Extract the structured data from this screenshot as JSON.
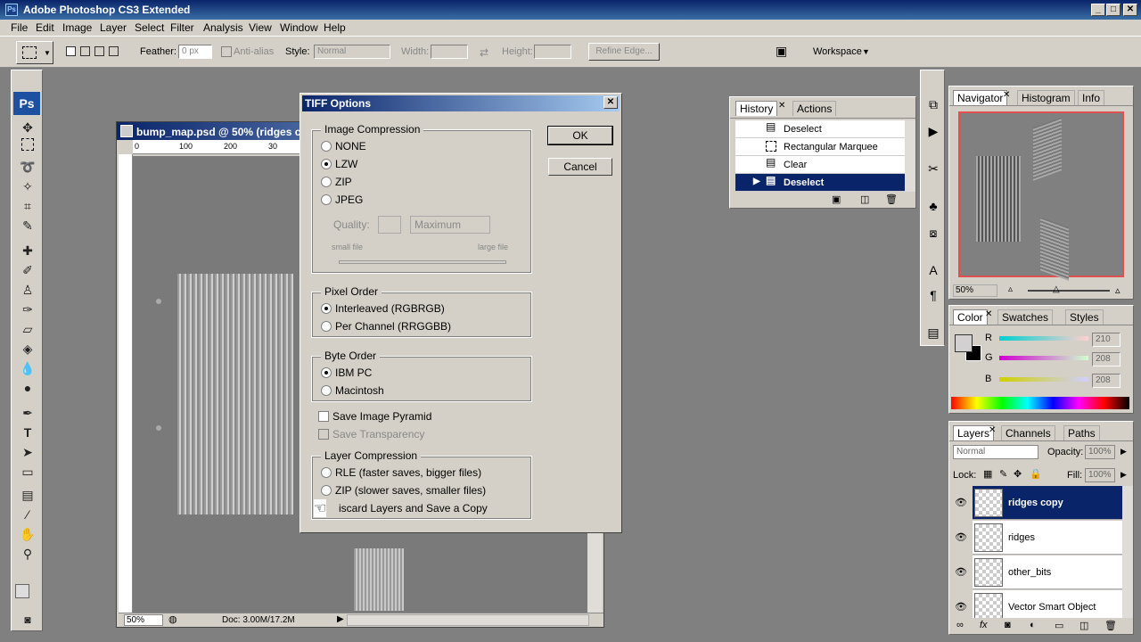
{
  "window": {
    "title": "Adobe Photoshop CS3 Extended",
    "app_icon": "Ps"
  },
  "menu": [
    "File",
    "Edit",
    "Image",
    "Layer",
    "Select",
    "Filter",
    "Analysis",
    "View",
    "Window",
    "Help"
  ],
  "options": {
    "feather_label": "Feather:",
    "feather_value": "0 px",
    "antialias_label": "Anti-alias",
    "style_label": "Style:",
    "style_value": "Normal",
    "width_label": "Width:",
    "height_label": "Height:",
    "refine_edge": "Refine Edge...",
    "workspace": "Workspace"
  },
  "toolbox": {
    "logo": "Ps"
  },
  "document": {
    "title": "bump_map.psd @ 50% (ridges c",
    "ruler_top": [
      "0",
      "100",
      "200",
      "30"
    ],
    "zoom": "50%",
    "doc_info": "Doc: 3.00M/17.2M"
  },
  "dialog": {
    "title": "TIFF Options",
    "ok": "OK",
    "cancel": "Cancel",
    "image_compression": {
      "label": "Image Compression",
      "options": [
        "NONE",
        "LZW",
        "ZIP",
        "JPEG"
      ],
      "selected": "LZW",
      "quality_label": "Quality:",
      "quality_select": "Maximum",
      "small_file": "small file",
      "large_file": "large file"
    },
    "pixel_order": {
      "label": "Pixel Order",
      "options": [
        "Interleaved (RGBRGB)",
        "Per Channel (RRGGBB)"
      ],
      "selected": "Interleaved (RGBRGB)"
    },
    "byte_order": {
      "label": "Byte Order",
      "options": [
        "IBM PC",
        "Macintosh"
      ],
      "selected": "IBM PC"
    },
    "save_pyramid": "Save Image Pyramid",
    "save_transparency": "Save Transparency",
    "layer_compression": {
      "label": "Layer Compression",
      "options": [
        "RLE (faster saves, bigger files)",
        "ZIP (slower saves, smaller files)",
        "Discard Layers and Save a Copy"
      ]
    },
    "discard_visible": "iscard Layers and Save a Copy"
  },
  "history": {
    "tabs": [
      "History",
      "Actions"
    ],
    "items": [
      "Deselect",
      "Rectangular Marquee",
      "Clear",
      "Deselect"
    ],
    "selected_index": 3
  },
  "navigator": {
    "tabs": [
      "Navigator",
      "Histogram",
      "Info"
    ],
    "zoom": "50%"
  },
  "color": {
    "tabs": [
      "Color",
      "Swatches",
      "Styles"
    ],
    "channels": [
      {
        "name": "R",
        "value": "210"
      },
      {
        "name": "G",
        "value": "208"
      },
      {
        "name": "B",
        "value": "208"
      }
    ]
  },
  "layers": {
    "tabs": [
      "Layers",
      "Channels",
      "Paths"
    ],
    "blend": "Normal",
    "opacity_label": "Opacity:",
    "opacity": "100%",
    "lock_label": "Lock:",
    "fill_label": "Fill:",
    "fill": "100%",
    "items": [
      "ridges copy",
      "ridges",
      "other_bits",
      "Vector Smart Object"
    ],
    "selected_index": 0
  }
}
